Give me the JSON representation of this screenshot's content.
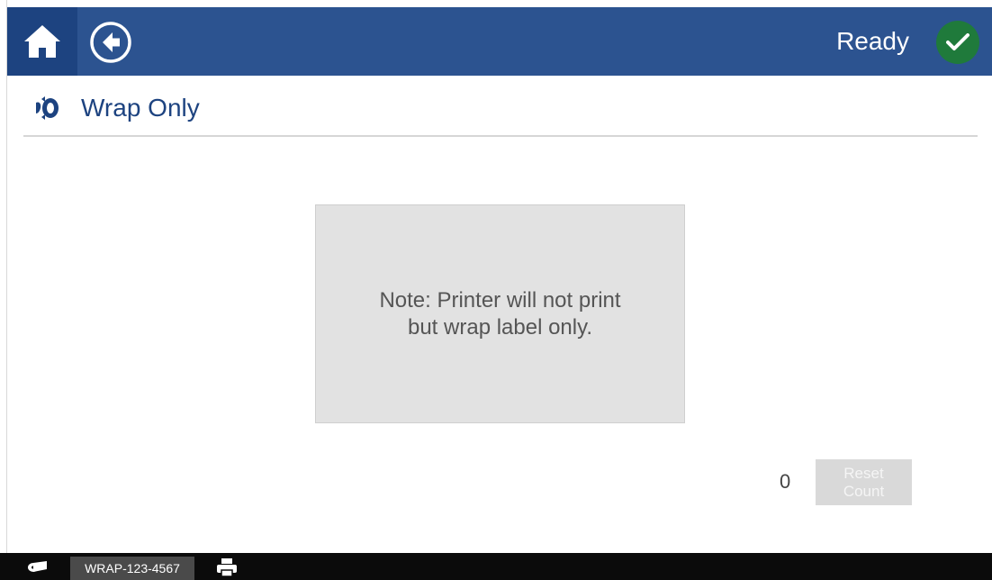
{
  "header": {
    "status_text": "Ready",
    "status_color": "#1f7a3b",
    "bar_color": "#2c5390",
    "home_icon": "home-icon",
    "back_icon": "back-arrow-icon",
    "status_icon": "checkmark-icon"
  },
  "page": {
    "title": "Wrap Only",
    "title_icon": "wrap-icon"
  },
  "note": {
    "line1": "Note: Printer will not print",
    "line2": "but wrap label only."
  },
  "counter": {
    "value": "0",
    "reset_label_line1": "Reset",
    "reset_label_line2": "Count"
  },
  "footer": {
    "media_icon": "label-roll-icon",
    "label_part": "WRAP-123-4567",
    "printer_icon": "printer-icon"
  }
}
